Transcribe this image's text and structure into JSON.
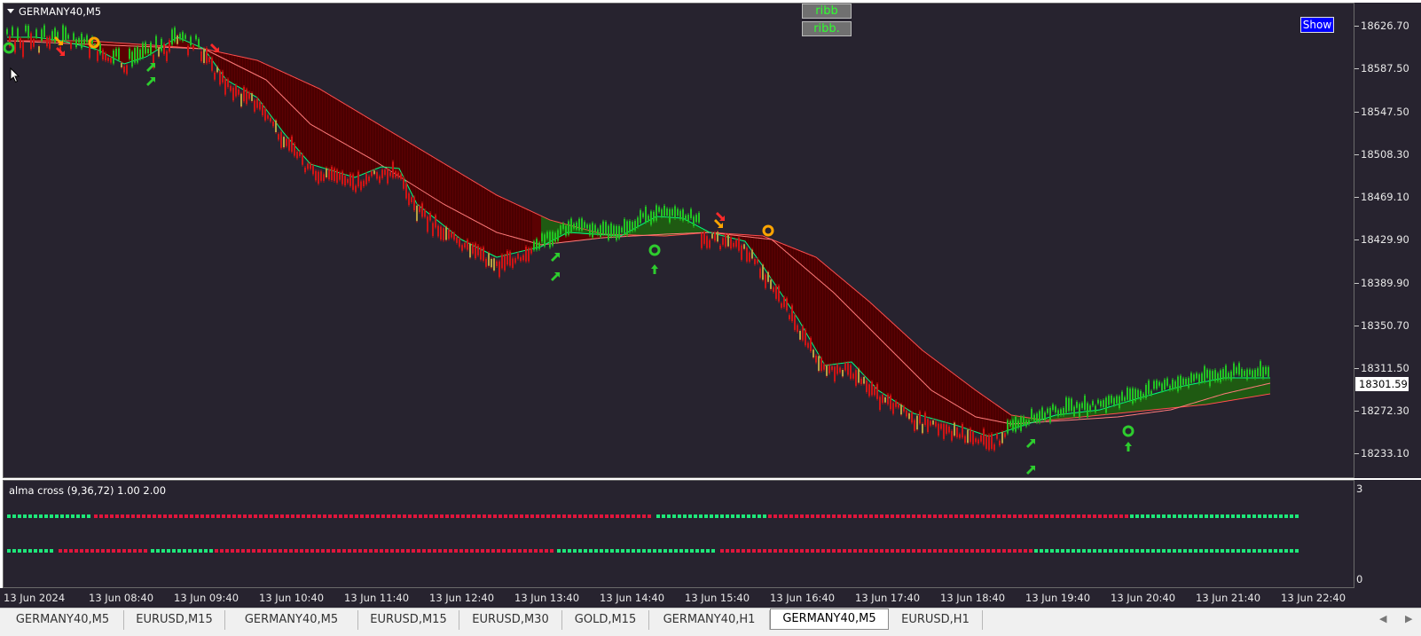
{
  "chart": {
    "symbol_title": "GERMANY40,M5",
    "current_price": "18301.59",
    "price_labels": [
      "18626.70",
      "18587.50",
      "18547.50",
      "18508.30",
      "18469.10",
      "18429.90",
      "18389.90",
      "18350.70",
      "18311.50",
      "18272.30",
      "18233.10"
    ],
    "price_values": [
      18626.7,
      18587.5,
      18547.5,
      18508.3,
      18469.1,
      18429.9,
      18389.9,
      18350.7,
      18311.5,
      18272.3,
      18233.1
    ],
    "buttons": {
      "ribb1": "ribb",
      "ribb2": "ribb.",
      "show": "Show"
    },
    "colors": {
      "background": "#27232f",
      "ribbon_bear": "#5e0000",
      "ribbon_bull": "#1f5a12",
      "fast_line": "#00ff7f",
      "bear_line": "#ff4d4d",
      "bull_arrow": "#2ecc2e",
      "bear_arrow": "#ff2a2a",
      "signal_orange": "#ffa500"
    }
  },
  "indicator": {
    "label": "alma cross (9,36,72) 1.00 2.00",
    "scale_top": "3",
    "scale_bottom": "0",
    "colors": {
      "bull": "#1ee87a",
      "bear": "#e0163c"
    }
  },
  "time_labels": [
    "13 Jun 2024",
    "13 Jun 08:40",
    "13 Jun 09:40",
    "13 Jun 10:40",
    "13 Jun 11:40",
    "13 Jun 12:40",
    "13 Jun 13:40",
    "13 Jun 14:40",
    "13 Jun 15:40",
    "13 Jun 16:40",
    "13 Jun 17:40",
    "13 Jun 18:40",
    "13 Jun 19:40",
    "13 Jun 20:40",
    "13 Jun 21:40",
    "13 Jun 22:40"
  ],
  "tabs": [
    "GERMANY40,M5",
    "EURUSD,M15",
    "GERMANY40,M5",
    "EURUSD,M15",
    "EURUSD,M30",
    "GOLD,M15",
    "GERMANY40,H1",
    "GERMANY40,M5",
    "EURUSD,H1"
  ],
  "active_tab_index": 7,
  "icons": {
    "scroll_left": "chevron-left-icon",
    "scroll_right": "chevron-right-icon",
    "pointer": "mouse-pointer-icon",
    "title_menu": "triangle-down-icon"
  }
}
